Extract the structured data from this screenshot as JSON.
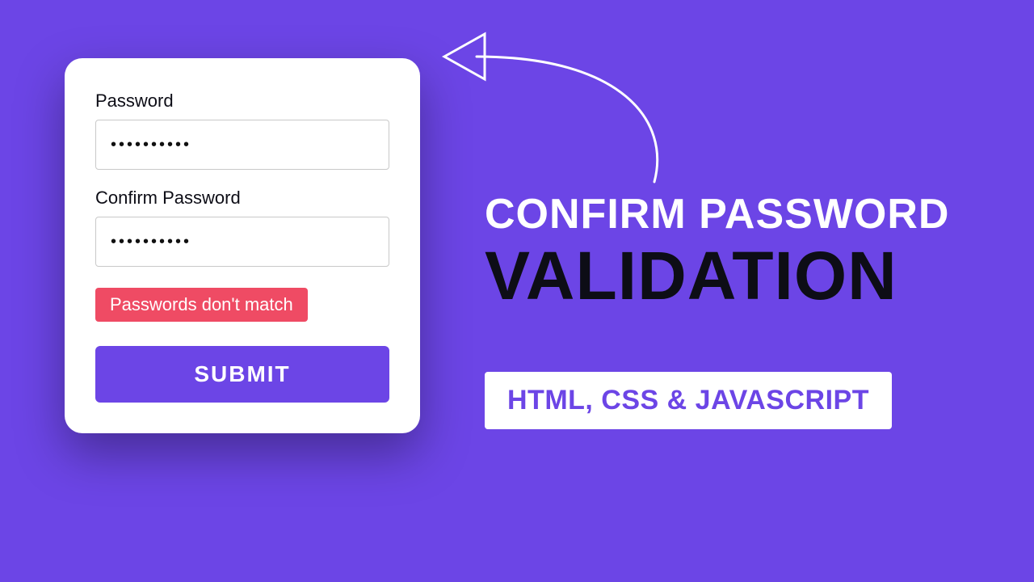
{
  "form": {
    "password_label": "Password",
    "confirm_label": "Confirm Password",
    "password_value": "••••••••••",
    "confirm_value": "••••••••••",
    "error_message": "Passwords don't match",
    "submit_label": "SUBMIT"
  },
  "hero": {
    "line1": "CONFIRM PASSWORD",
    "line2": "VALIDATION",
    "tag": "HTML, CSS & JAVASCRIPT"
  },
  "colors": {
    "accent": "#6c45e6",
    "error": "#ef4b64",
    "dark": "#0d0d16"
  }
}
